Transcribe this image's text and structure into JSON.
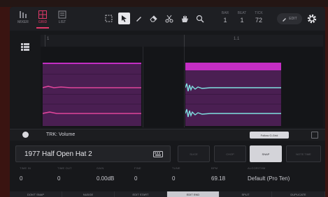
{
  "header": {
    "modes": [
      {
        "label": "MIXER",
        "icon": "mixer-icon",
        "active": false
      },
      {
        "label": "GRID",
        "icon": "grid-icon",
        "active": true
      },
      {
        "label": "LIST",
        "icon": "list-icon",
        "active": false
      }
    ],
    "tools": [
      "marquee-select-icon",
      "pointer-icon",
      "pencil-icon",
      "eraser-icon",
      "scissors-icon",
      "hand-icon",
      "zoom-icon"
    ],
    "fields": [
      {
        "label": "BAR",
        "value": "1"
      },
      {
        "label": "BEAT",
        "value": "1"
      },
      {
        "label": "TICK",
        "value": "72"
      }
    ],
    "edit_label": "EDIT"
  },
  "ruler": {
    "markers": [
      "1",
      "1.1"
    ]
  },
  "automation": {
    "param_label": "TRK: Volume",
    "follow_label": "Follow G-Grid"
  },
  "sample": {
    "name": "1977 Half Open Hat 2",
    "tabs": [
      {
        "label": "SLICE",
        "active": false
      },
      {
        "label": "CHOP",
        "active": false
      },
      {
        "label": "SNAP",
        "active": true
      },
      {
        "label": "NOTE TIME",
        "active": false
      }
    ]
  },
  "params": [
    {
      "label": "TIME IN",
      "value": "0"
    },
    {
      "label": "TIME OUT",
      "value": "0"
    },
    {
      "label": "GAIN",
      "value": "0.00dB"
    },
    {
      "label": "FINE",
      "value": "0"
    },
    {
      "label": "TUNE",
      "value": "0"
    },
    {
      "label": "BPM",
      "value": "69.18"
    },
    {
      "label": "ALGORITHM",
      "value": "Default (Pro Ten)"
    }
  ],
  "bottom_bar": [
    {
      "label": "DON'T SNAP",
      "active": false
    },
    {
      "label": "NUDGE",
      "active": false
    },
    {
      "label": "EDIT START",
      "active": false
    },
    {
      "label": "EDIT END",
      "active": true
    },
    {
      "label": "SPLIT",
      "active": false
    },
    {
      "label": "DUPLICATE",
      "active": false
    }
  ],
  "colors": {
    "accent": "#e23a6a",
    "clip": "#c42ec4",
    "waveform": "#7fe0e0"
  }
}
